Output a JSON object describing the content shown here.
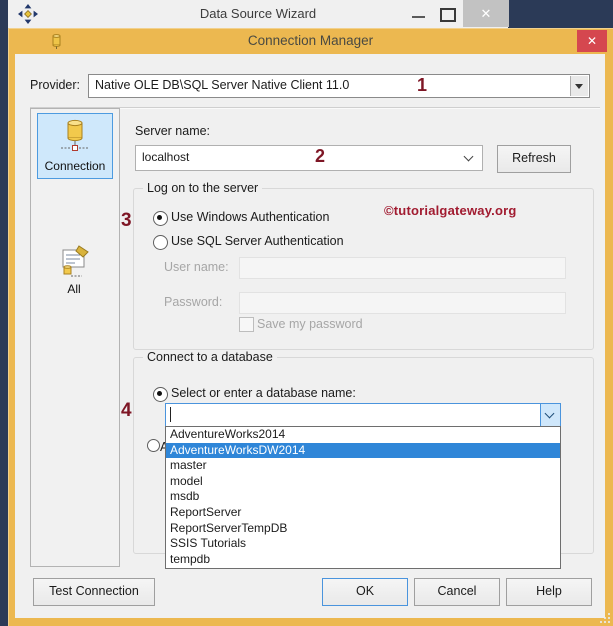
{
  "wizard": {
    "title": "Data Source Wizard",
    "close_glyph": "✕"
  },
  "dialog": {
    "title": "Connection Manager",
    "close_glyph": "✕",
    "provider": {
      "label": "Provider:",
      "value": "Native OLE DB\\SQL Server Native Client 11.0"
    },
    "sidebar": {
      "connection_label": "Connection",
      "all_label": "All"
    },
    "server": {
      "label": "Server name:",
      "value": "localhost",
      "refresh_label": "Refresh"
    },
    "logon_group": {
      "title": "Log on to the server",
      "windows_auth_label": "Use Windows Authentication",
      "sql_auth_label": "Use SQL Server Authentication",
      "username_label": "User name:",
      "password_label": "Password:",
      "save_password_label": "Save my password",
      "watermark": "©tutorialgateway.org"
    },
    "database_group": {
      "title": "Connect to a database",
      "select_radio_label": "Select or enter a database name:",
      "attach_radio_partial_label": "A",
      "combo_value": "",
      "dropdown_items": [
        "AdventureWorks2014",
        "AdventureWorksDW2014",
        "master",
        "model",
        "msdb",
        "ReportServer",
        "ReportServerTempDB",
        "SSIS Tutorials",
        "tempdb"
      ],
      "selected_item": "AdventureWorksDW2014"
    },
    "annotations": {
      "one": "1",
      "two": "2",
      "three": "3",
      "four": "4"
    },
    "buttons": {
      "test": "Test Connection",
      "ok": "OK",
      "cancel": "Cancel",
      "help": "Help"
    },
    "colors": {
      "dialog_chrome": "#ecb850",
      "close_button": "#d5474f",
      "desktop_navy": "#2b3a57",
      "selection_blue": "#2f86d8",
      "annotation_red": "#7e1625",
      "watermark_red": "#a11b30"
    }
  }
}
